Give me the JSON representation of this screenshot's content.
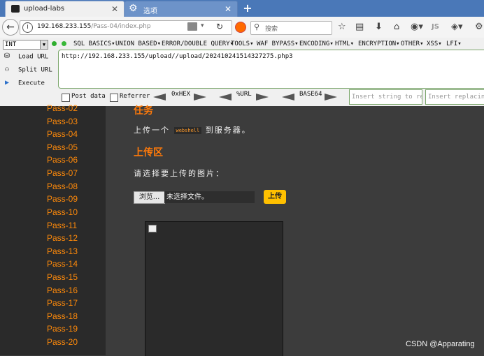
{
  "tabs": [
    {
      "label": "upload-labs",
      "icon": "site-favicon"
    },
    {
      "label": "选项",
      "icon": "gear-icon"
    }
  ],
  "nav": {
    "url_host": "192.168.233.155",
    "url_path": "/Pass-04/index.php",
    "search_placeholder": "搜索"
  },
  "hackbar": {
    "select_value": "INT",
    "menu": [
      "SQL BASICS▾",
      "UNION BASED▾",
      "ERROR/DOUBLE QUERY▾",
      "TOOLS▾",
      "WAF BYPASS▾",
      "ENCODING▾",
      "HTML▾",
      "ENCRYPTION▾",
      "OTHER▾",
      "XSS▾",
      "LFI▾"
    ],
    "buttons": [
      "Load URL",
      "Split URL",
      "Execute"
    ],
    "textarea": "http://192.168.233.155/upload//upload/202410241514327275.php3",
    "post_data": "Post data",
    "referrer": "Referrer",
    "hex": "0xHEX",
    "urlenc": "%URL",
    "base64": "BASE64",
    "insert1_placeholder": "Insert string to replace",
    "insert2_placeholder": "Insert replacing string"
  },
  "sidebar": {
    "items": [
      "Pass-02",
      "Pass-03",
      "Pass-04",
      "Pass-05",
      "Pass-06",
      "Pass-07",
      "Pass-08",
      "Pass-09",
      "Pass-10",
      "Pass-11",
      "Pass-12",
      "Pass-13",
      "Pass-14",
      "Pass-15",
      "Pass-16",
      "Pass-17",
      "Pass-18",
      "Pass-19",
      "Pass-20"
    ]
  },
  "main": {
    "task_title": "任务",
    "task_text_before": "上传一个",
    "task_code": "webshell",
    "task_text_after": "到服务器。",
    "upload_title": "上传区",
    "upload_hint": "请选择要上传的图片：",
    "browse_label": "浏览...",
    "file_status": "未选择文件。",
    "upload_button": "上传"
  },
  "watermark": "CSDN @Apparating",
  "colors": {
    "accent": "#ff8a0a",
    "upload_btn": "#ffc000",
    "tabstrip": "#4a78b8"
  }
}
